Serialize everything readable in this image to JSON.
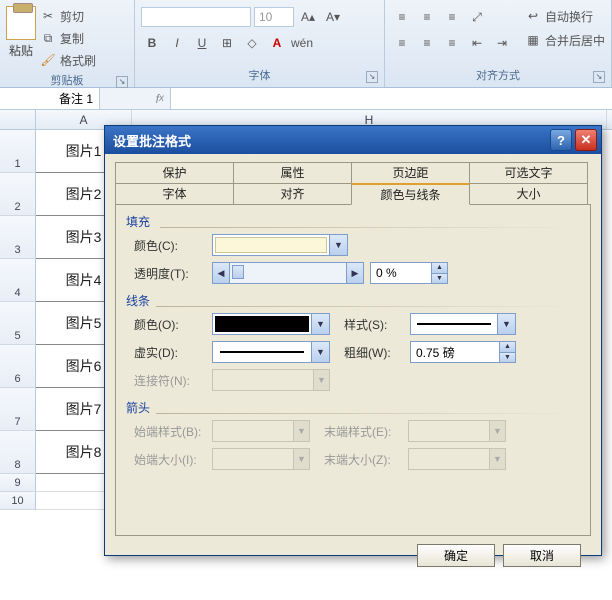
{
  "ribbon": {
    "clipboard": {
      "title": "剪贴板",
      "paste": "粘贴",
      "cut": "剪切",
      "copy": "复制",
      "format_painter": "格式刷"
    },
    "font": {
      "title": "字体",
      "size_placeholder": "10"
    },
    "align": {
      "title": "对齐方式",
      "wrap": "自动换行",
      "merge": "合并后居中"
    }
  },
  "namebox": "备注 1",
  "columns": [
    "A",
    "",
    "",
    "",
    "",
    "H"
  ],
  "rows": [
    "1",
    "2",
    "3",
    "4",
    "5",
    "6",
    "7",
    "8",
    "9",
    "10"
  ],
  "cellsA": [
    "图片1",
    "图片2",
    "图片3",
    "图片4",
    "图片5",
    "图片6",
    "图片7",
    "图片8"
  ],
  "dialog": {
    "title": "设置批注格式",
    "tabs_row1": [
      "保护",
      "属性",
      "页边距",
      "可选文字"
    ],
    "tabs_row2": [
      "字体",
      "对齐",
      "颜色与线条",
      "大小"
    ],
    "active_tab": "颜色与线条",
    "fill": {
      "legend": "填充",
      "color_label": "颜色(C):",
      "transparency_label": "透明度(T):",
      "transparency_value": "0 %"
    },
    "line": {
      "legend": "线条",
      "color_label": "颜色(O):",
      "style_label": "样式(S):",
      "dash_label": "虚实(D):",
      "weight_label": "粗细(W):",
      "weight_value": "0.75 磅",
      "connector_label": "连接符(N):"
    },
    "arrow": {
      "legend": "箭头",
      "begin_style": "始端样式(B):",
      "end_style": "末端样式(E):",
      "begin_size": "始端大小(I):",
      "end_size": "末端大小(Z):"
    },
    "ok": "确定",
    "cancel": "取消"
  }
}
